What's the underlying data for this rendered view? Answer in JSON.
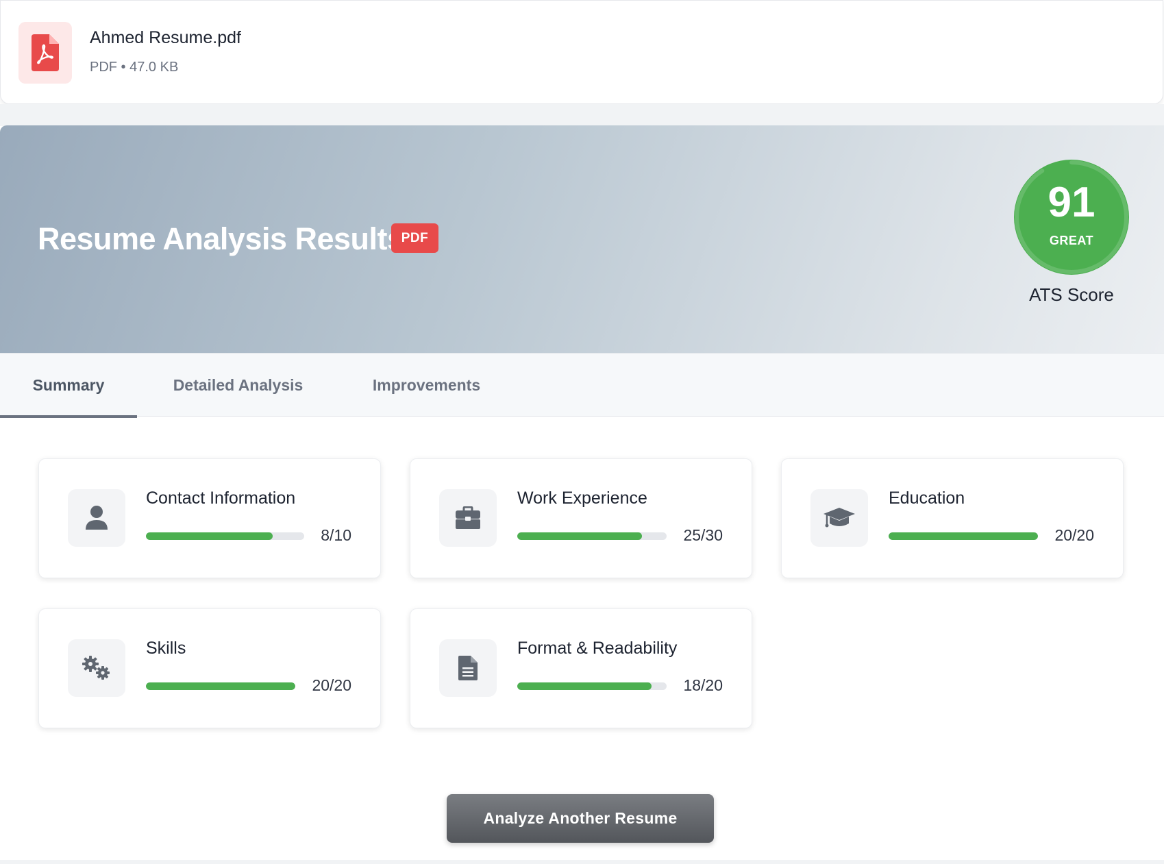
{
  "file": {
    "name": "Ahmed Resume.pdf",
    "meta": "PDF • 47.0 KB",
    "icon": "file-pdf-icon"
  },
  "hero": {
    "title": "Resume Analysis Results",
    "badge": "PDF",
    "score": "91",
    "score_value": 91,
    "score_max": 100,
    "score_rating": "GREAT",
    "score_caption": "ATS Score",
    "score_color": "#4caf50"
  },
  "tabs": [
    {
      "label": "Summary",
      "active": true
    },
    {
      "label": "Detailed Analysis",
      "active": false
    },
    {
      "label": "Improvements",
      "active": false
    }
  ],
  "categories": [
    {
      "title": "Contact Information",
      "score": "8/10",
      "value": 8,
      "max": 10,
      "icon": "user-icon"
    },
    {
      "title": "Work Experience",
      "score": "25/30",
      "value": 25,
      "max": 30,
      "icon": "briefcase-icon"
    },
    {
      "title": "Education",
      "score": "20/20",
      "value": 20,
      "max": 20,
      "icon": "graduation-cap-icon"
    },
    {
      "title": "Skills",
      "score": "20/20",
      "value": 20,
      "max": 20,
      "icon": "gears-icon"
    },
    {
      "title": "Format & Readability",
      "score": "18/20",
      "value": 18,
      "max": 20,
      "icon": "document-icon"
    }
  ],
  "actions": {
    "analyze_another": "Analyze Another Resume"
  },
  "colors": {
    "accent_green": "#4caf50",
    "badge_red": "#e84a4a",
    "icon_gray": "#5f6670"
  }
}
